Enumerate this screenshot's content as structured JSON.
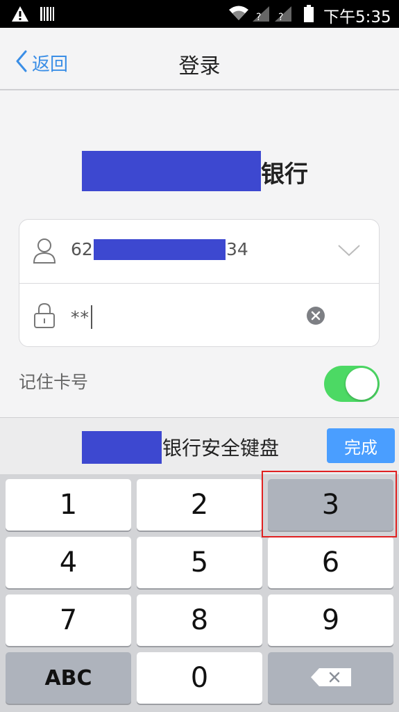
{
  "status_bar": {
    "time": "下午5:35",
    "icons": [
      "warning-icon",
      "barcode-icon",
      "wifi-icon",
      "signal-icon",
      "signal-icon",
      "battery-icon"
    ]
  },
  "nav": {
    "back_label": "返回",
    "title": "登录"
  },
  "bank": {
    "name_suffix": "银行"
  },
  "login": {
    "account_prefix": "62",
    "account_suffix": "34",
    "password_value": "**"
  },
  "remember": {
    "label": "记住卡号",
    "enabled": true
  },
  "keyboard": {
    "title_suffix": "银行安全键盘",
    "done_label": "完成",
    "keys": [
      "1",
      "2",
      "3",
      "4",
      "5",
      "6",
      "7",
      "8",
      "9",
      "ABC",
      "0"
    ],
    "highlighted_key": "3"
  },
  "colors": {
    "accent": "#3a8ee6",
    "done_button": "#4a9eff",
    "toggle_on": "#4cd964",
    "redaction": "#3d48d0",
    "highlight": "#e02020"
  }
}
